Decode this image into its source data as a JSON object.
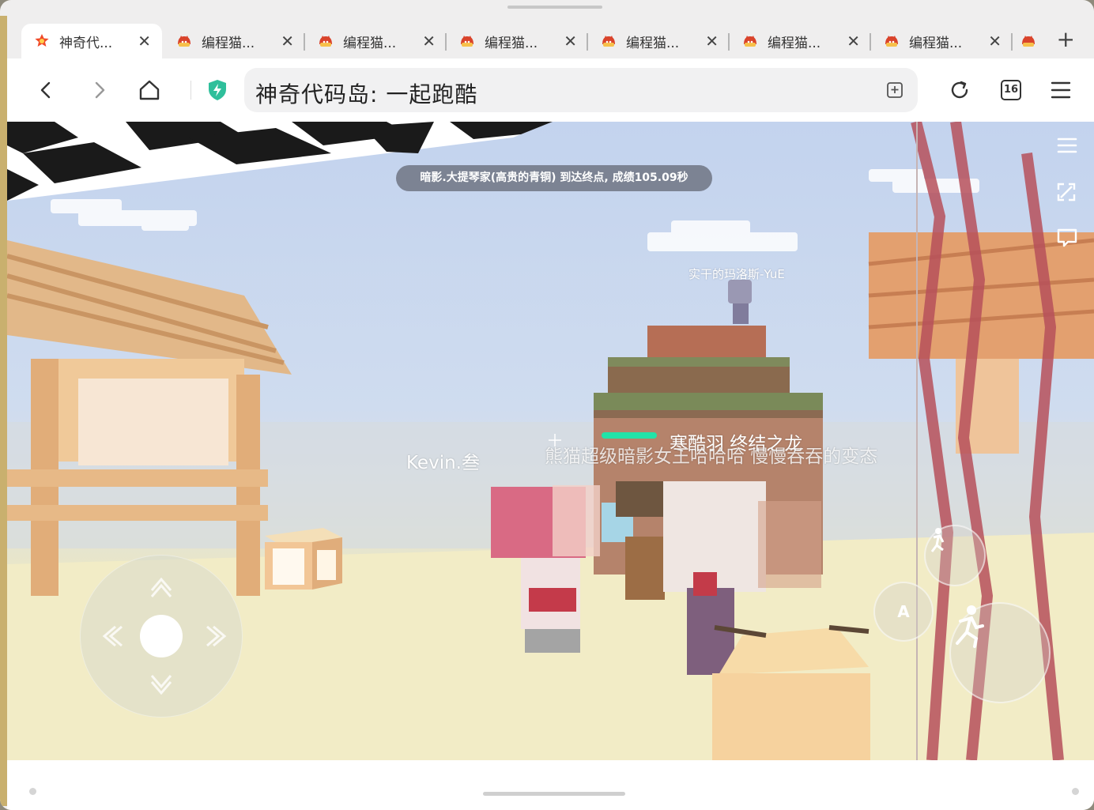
{
  "browser": {
    "tabs": [
      {
        "label": "神奇代...",
        "active": true,
        "favicon": "codemao-star-icon"
      },
      {
        "label": "编程猫...",
        "active": false,
        "favicon": "codemao-cat-icon"
      },
      {
        "label": "编程猫...",
        "active": false,
        "favicon": "codemao-cat-icon"
      },
      {
        "label": "编程猫...",
        "active": false,
        "favicon": "codemao-cat-icon"
      },
      {
        "label": "编程猫...",
        "active": false,
        "favicon": "codemao-cat-icon"
      },
      {
        "label": "编程猫...",
        "active": false,
        "favicon": "codemao-cat-icon"
      },
      {
        "label": "编程猫...",
        "active": false,
        "favicon": "codemao-cat-icon"
      }
    ],
    "close_glyph": "✕",
    "new_tab_glyph": "+",
    "address": "神奇代码岛: 一起跑酷",
    "tab_count": "16",
    "colors": {
      "shield": "#2fbf9b",
      "brand": "#f04a2a"
    }
  },
  "game": {
    "toast": "暗影.大提琴家(高贵的青铜) 到达终点, 成绩105.09秒",
    "nametags": {
      "top_player": "实干的玛洛斯-YuE",
      "left_player": "Kevin.叁",
      "right_player": "寒酷羽 终结之龙",
      "overlapping_players": "熊猫超级暗影女王哈哈哈 慢慢吞吞的变态"
    },
    "action_button_label": "A",
    "health_color": "#22e3a8"
  }
}
